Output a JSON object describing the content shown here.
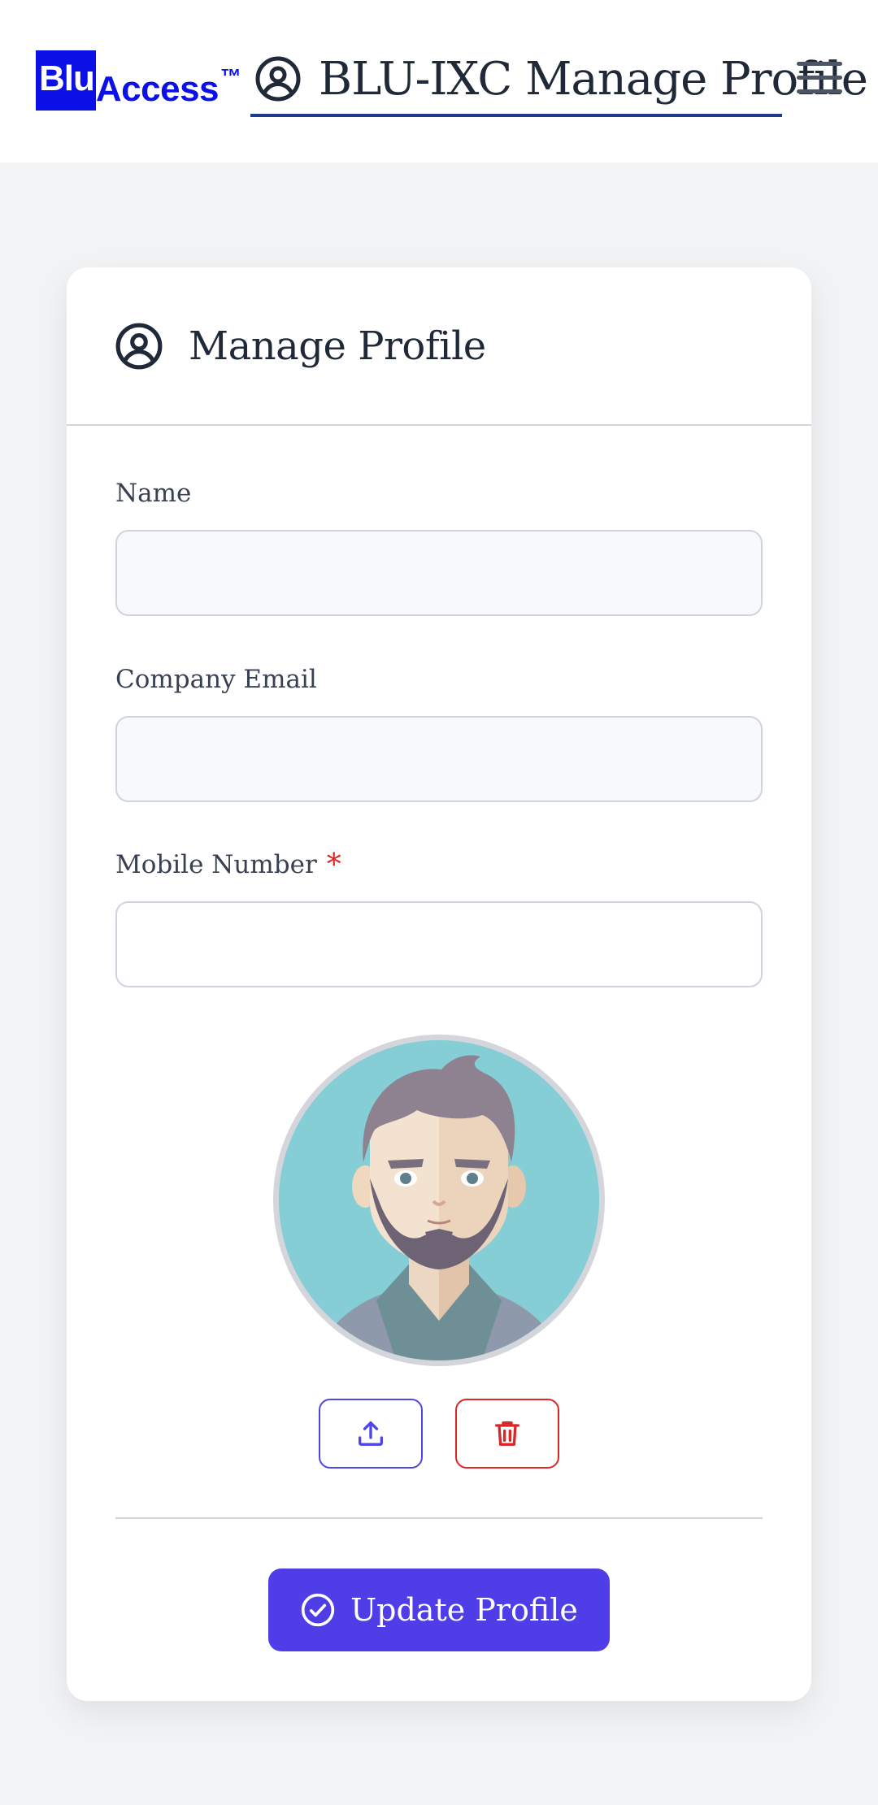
{
  "header": {
    "logo": {
      "box_text": "Blu",
      "rest_text": "Access",
      "tm": "™"
    },
    "title": "BLU-IXC Manage Profile",
    "menu_icon": "hamburger-icon",
    "title_icon": "user-circle-icon"
  },
  "card": {
    "title": "Manage Profile",
    "title_icon": "user-circle-icon"
  },
  "form": {
    "name": {
      "label": "Name",
      "value": "",
      "placeholder": ""
    },
    "email": {
      "label": "Company Email",
      "value": "",
      "placeholder": ""
    },
    "mobile": {
      "label": "Mobile Number",
      "required_mark": "*",
      "value": "",
      "placeholder": ""
    }
  },
  "avatar": {
    "icon": "avatar-illustration"
  },
  "actions": {
    "upload_icon": "upload-icon",
    "delete_icon": "trash-icon",
    "submit_label": "Update Profile",
    "submit_icon": "check-circle-icon"
  },
  "colors": {
    "brand_blue": "#0b10e6",
    "primary": "#4f3de8",
    "danger": "#dc2626",
    "background": "#f2f3f5",
    "avatar_bg": "#86ced6"
  }
}
